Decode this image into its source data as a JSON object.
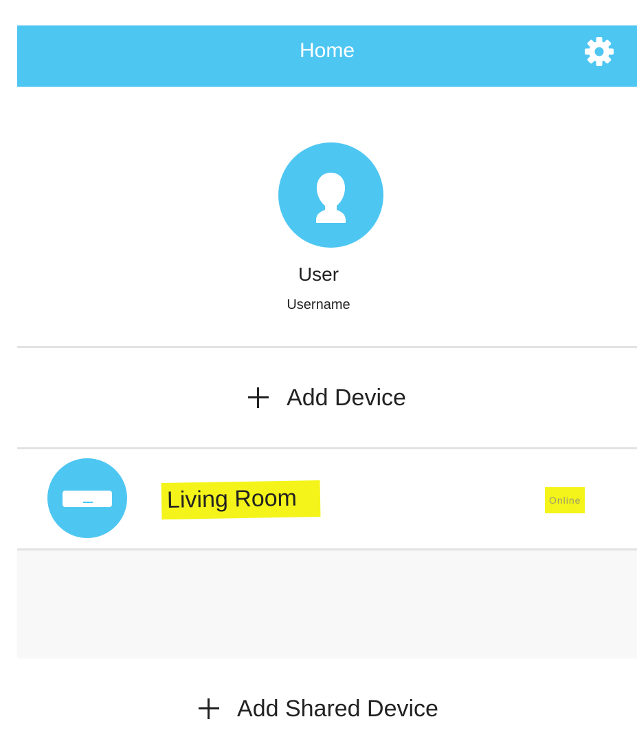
{
  "header": {
    "title": "Home",
    "settings_icon": "gear-icon"
  },
  "profile": {
    "avatar_icon": "user-icon",
    "name": "User",
    "username": "Username"
  },
  "actions": {
    "add_device": "Add Device",
    "add_shared_device": "Add Shared Device"
  },
  "devices": [
    {
      "name": "Living Room",
      "status": "Online",
      "icon": "air-conditioner-icon"
    }
  ],
  "colors": {
    "accent": "#4ec6f2",
    "highlight": "#f4f41a",
    "background": "#ffffff",
    "muted": "#f8f8f9"
  }
}
